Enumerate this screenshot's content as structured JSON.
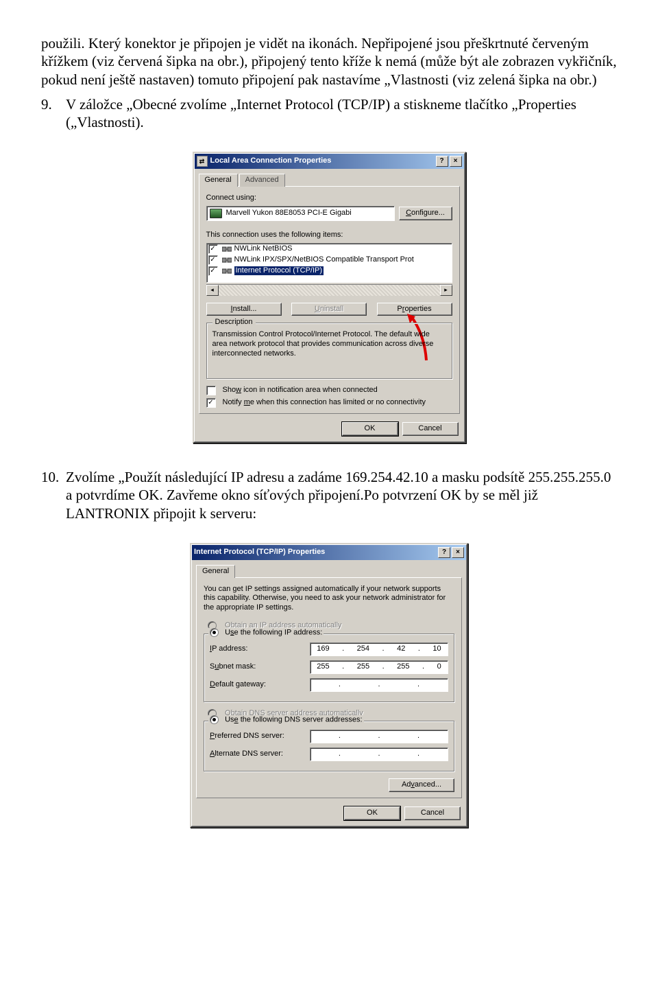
{
  "para0": "použili. Který konektor je připojen je vidět na ikonách. Nepřipojené jsou přeškrtnuté červeným křížkem (viz červená  šipka na obr.), připojený tento kříže k nemá (může být ale zobrazen vykřičník, pokud není ještě nastaven) tomuto připojení pak nastavíme „Vlastnosti (viz zelená šipka na obr.)",
  "step9_num": "9.",
  "step9": "V záložce „Obecné zvolíme „Internet Protocol (TCP/IP)   a stiskneme tlačítko „Properties („Vlastnosti).",
  "step10_num": "10.",
  "step10": "Zvolíme „Použít následující IP adresu a zadáme 169.254.42.10 a masku podsítě 255.255.255.0 a potvrdíme OK. Zavřeme okno síťových připojení.Po potvrzení OK by se měl již LANTRONIX připojit k serveru:",
  "dlg1": {
    "title": "Local Area Connection Properties",
    "tab_general": "General",
    "tab_advanced": "Advanced",
    "connect_using": "Connect using:",
    "nic": "Marvell Yukon 88E8053 PCI-E Gigabi",
    "configure": "Configure...",
    "uses_items": "This connection uses the following items:",
    "item1": "NWLink NetBIOS",
    "item2": "NWLink IPX/SPX/NetBIOS Compatible Transport Prot",
    "item3": "Internet Protocol (TCP/IP)",
    "install": "Install...",
    "uninstall": "Uninstall",
    "properties": "Properties",
    "desc_label": "Description",
    "desc": "Transmission Control Protocol/Internet Protocol. The default wide area network protocol that provides communication across diverse interconnected networks.",
    "show_icon": "Show icon in notification area when connected",
    "notify": "Notify me when this connection has limited or no connectivity",
    "ok": "OK",
    "cancel": "Cancel"
  },
  "dlg2": {
    "title": "Internet Protocol (TCP/IP) Properties",
    "tab_general": "General",
    "intro": "You can get IP settings assigned automatically if your network supports this capability. Otherwise, you need to ask your network administrator for the appropriate IP settings.",
    "obtain_ip": "Obtain an IP address automatically",
    "use_ip": "Use the following IP address:",
    "ip_label": "IP address:",
    "ip": [
      "169",
      "254",
      "42",
      "10"
    ],
    "mask_label": "Subnet mask:",
    "mask": [
      "255",
      "255",
      "255",
      "0"
    ],
    "gw_label": "Default gateway:",
    "obtain_dns": "Obtain DNS server address automatically",
    "use_dns": "Use the following DNS server addresses:",
    "pref_dns": "Preferred DNS server:",
    "alt_dns": "Alternate DNS server:",
    "advanced": "Advanced...",
    "ok": "OK",
    "cancel": "Cancel"
  }
}
